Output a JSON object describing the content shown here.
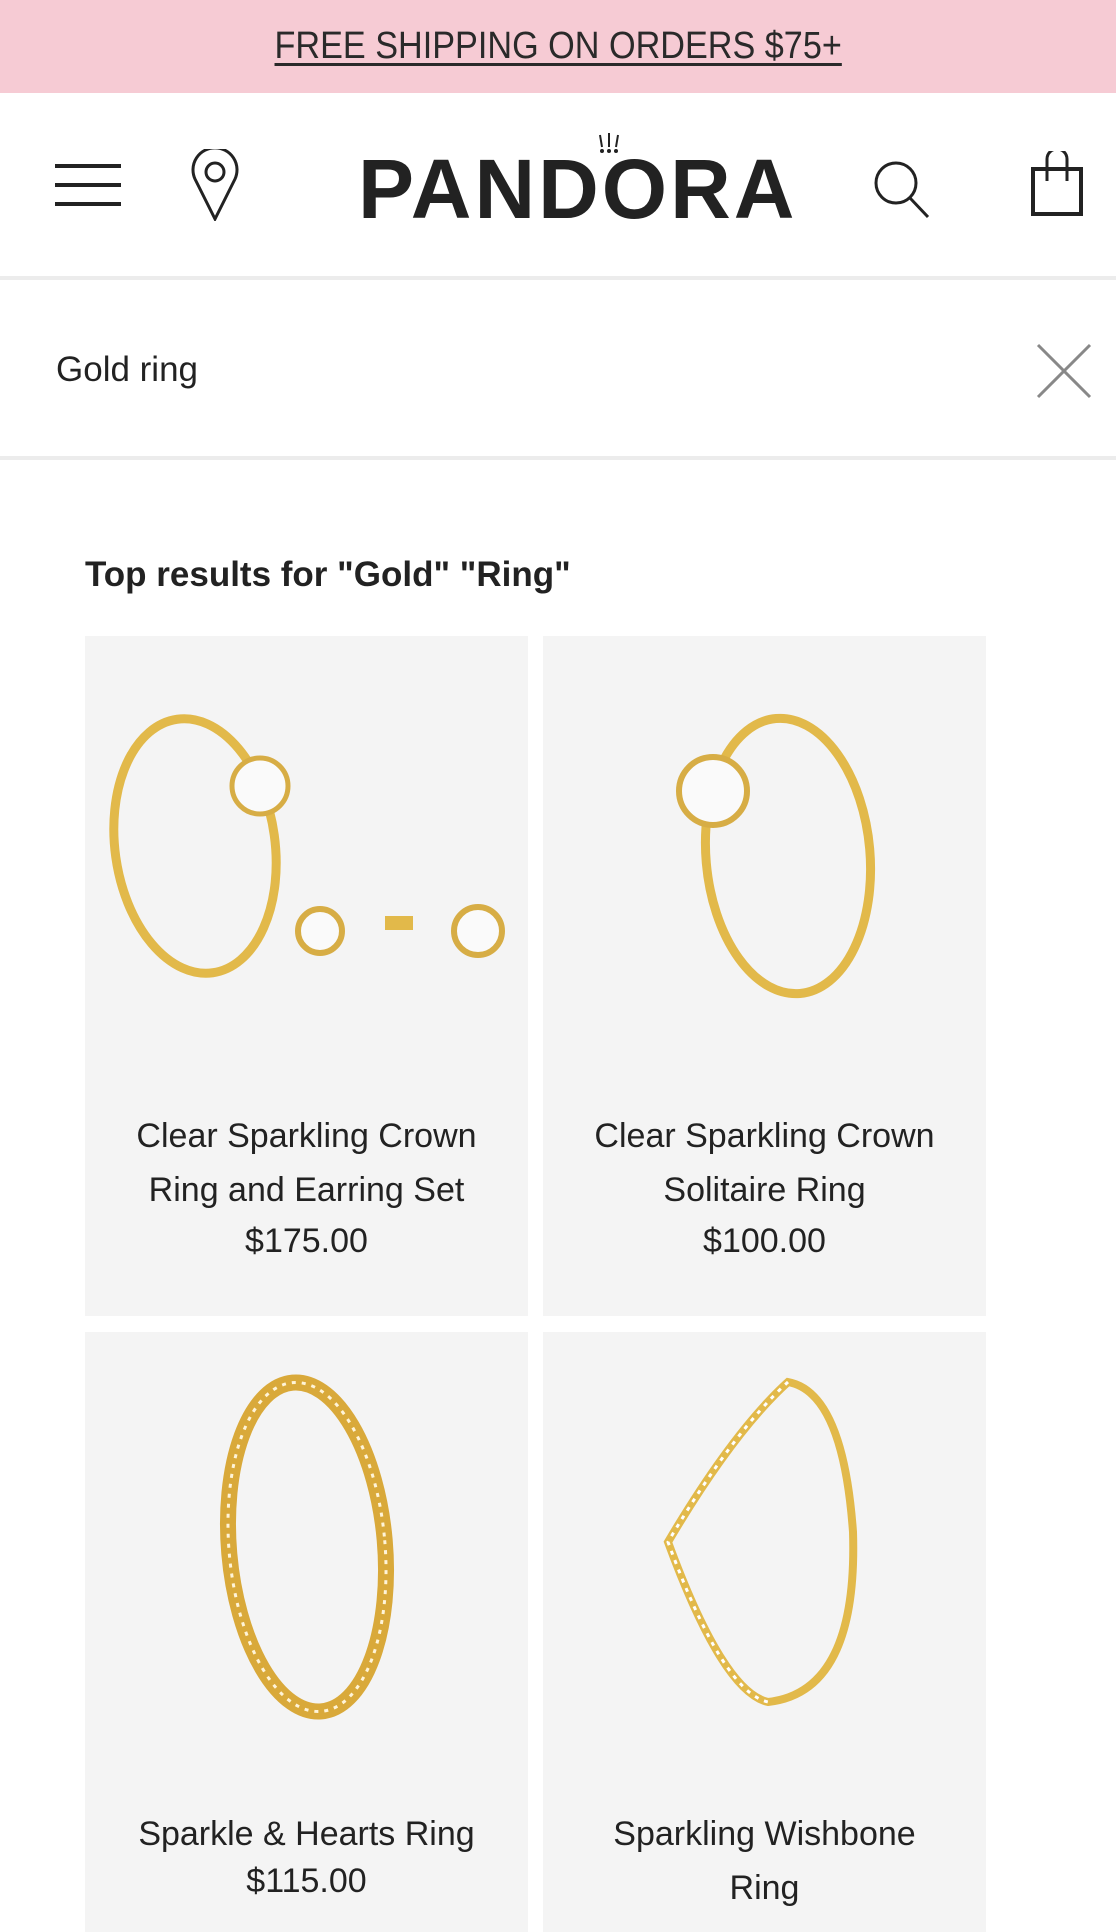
{
  "banner": {
    "text": "FREE SHIPPING ON ORDERS $75+",
    "color": "#f6cbd4"
  },
  "header": {
    "logo": "PANDORA",
    "icons": [
      "menu-icon",
      "location-pin-icon",
      "search-icon",
      "shopping-bag-icon"
    ]
  },
  "search": {
    "value": "Gold ring",
    "clear_icon": "close-icon"
  },
  "results": {
    "heading": "Top results for \"Gold\" \"Ring\"",
    "products": [
      {
        "title_lines": [
          "Clear Sparkling Crown",
          "Ring and Earring Set"
        ],
        "price": "$175.00"
      },
      {
        "title_lines": [
          "Clear Sparkling Crown",
          "Solitaire Ring"
        ],
        "price": "$100.00"
      },
      {
        "title_lines": [
          "Sparkle & Hearts Ring"
        ],
        "price": "$115.00"
      },
      {
        "title_lines": [
          "Sparkling Wishbone",
          "Ring"
        ],
        "price": ""
      }
    ]
  }
}
